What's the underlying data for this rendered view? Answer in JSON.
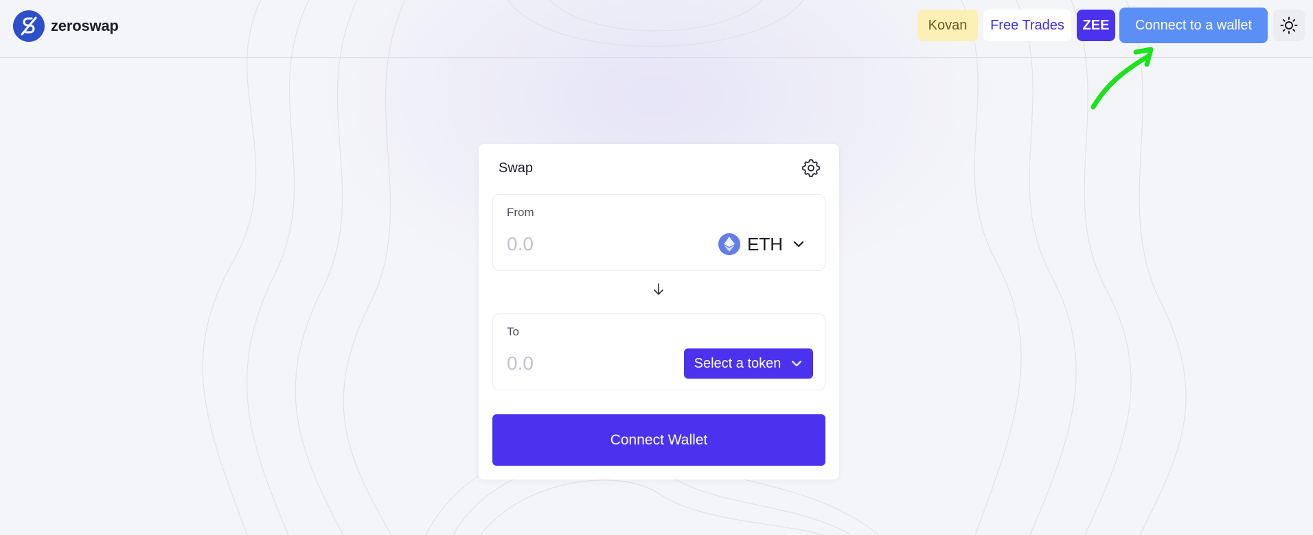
{
  "app": {
    "name": "zeroswap"
  },
  "header": {
    "network_badge": "Kovan",
    "free_trades_label": "Free Trades",
    "zee_label": "ZEE",
    "connect_label": "Connect to a wallet",
    "theme_icon": "sun-icon"
  },
  "swap": {
    "title": "Swap",
    "settings_icon": "gear-icon",
    "from": {
      "label": "From",
      "placeholder": "0.0",
      "token": "ETH"
    },
    "to": {
      "label": "To",
      "placeholder": "0.0",
      "select_label": "Select a token"
    },
    "connect_wallet_label": "Connect Wallet"
  },
  "colors": {
    "brand_primary": "#4b32ef",
    "connect_header": "#5b8ff5",
    "kovan_badge": "#fbf0b6",
    "annotation_arrow": "#1ee21e"
  }
}
